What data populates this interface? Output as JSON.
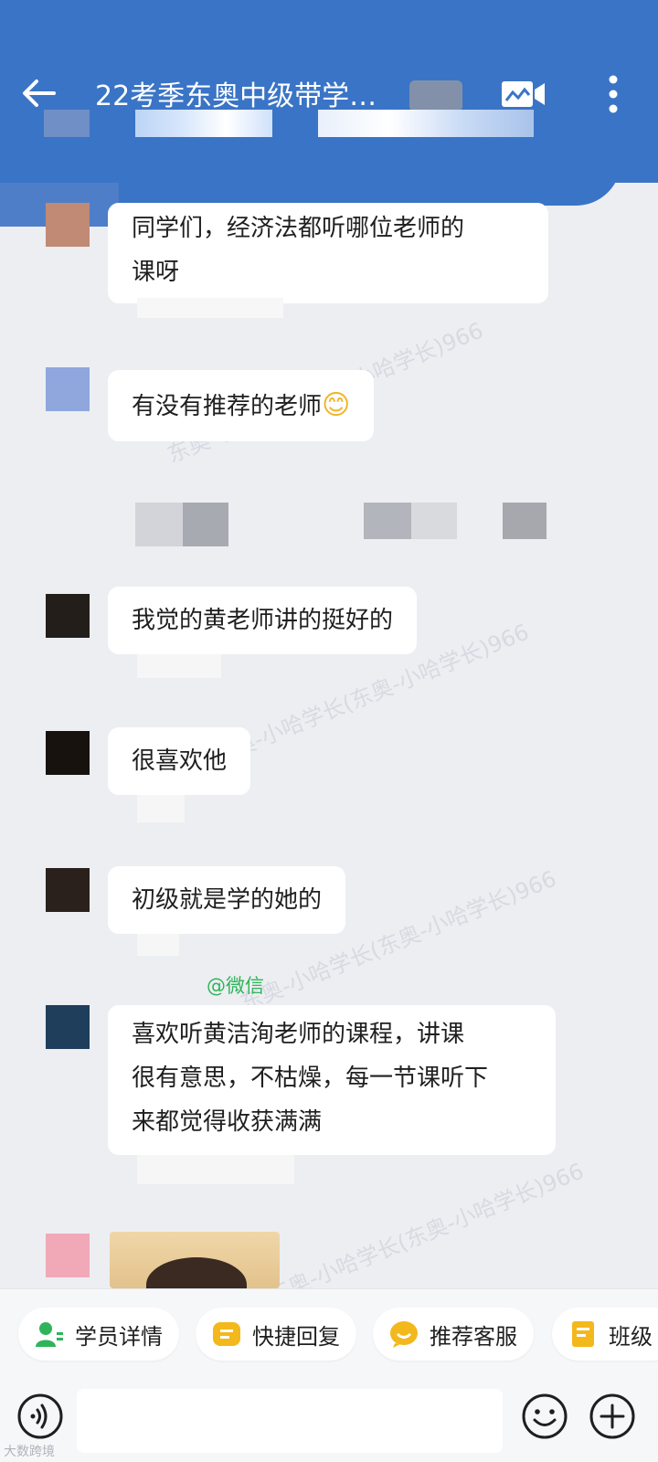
{
  "header": {
    "title": "22考季东奥中级带学…",
    "back_icon": "arrow-left-icon",
    "video_icon": "video-call-icon",
    "more_icon": "more-vertical-icon"
  },
  "messages": [
    {
      "text_lines": [
        "同学们，经济法都听哪位老师的",
        "课呀"
      ],
      "avatar_color": "#c08a74"
    },
    {
      "text_lines": [
        "有没有推荐的老师"
      ],
      "emoji": "😊",
      "avatar_color": "#8fa7dc"
    },
    {
      "text_lines": [
        "我觉的黄老师讲的挺好的"
      ],
      "avatar_color": "#241e1b"
    },
    {
      "text_lines": [
        "很喜欢他"
      ],
      "avatar_color": "#17120d"
    },
    {
      "text_lines": [
        "初级就是学的她的"
      ],
      "avatar_color": "#2b211c"
    },
    {
      "source_label": "@微信",
      "text_lines": [
        "喜欢听黄洁洵老师的课程，讲课",
        "很有意思，不枯燥，每一节课听下",
        "来都觉得收获满满"
      ],
      "avatar_color": "#1f3e5c"
    }
  ],
  "watermark_text": "东奥-小哈学长(东奥-小哈学长)966",
  "quick_actions": [
    {
      "label": "学员详情",
      "icon": "user-detail-icon",
      "color": "#2fb45a"
    },
    {
      "label": "快捷回复",
      "icon": "quick-reply-icon",
      "color": "#f3b81c"
    },
    {
      "label": "推荐客服",
      "icon": "service-icon",
      "color": "#f3b81c"
    },
    {
      "label": "班级",
      "icon": "class-icon",
      "color": "#f3b81c"
    }
  ],
  "input": {
    "placeholder": ""
  },
  "footer_watermark": "大数跨境",
  "colors": {
    "header": "#3a74c6",
    "background": "#eceef2",
    "bubble": "#ffffff"
  }
}
